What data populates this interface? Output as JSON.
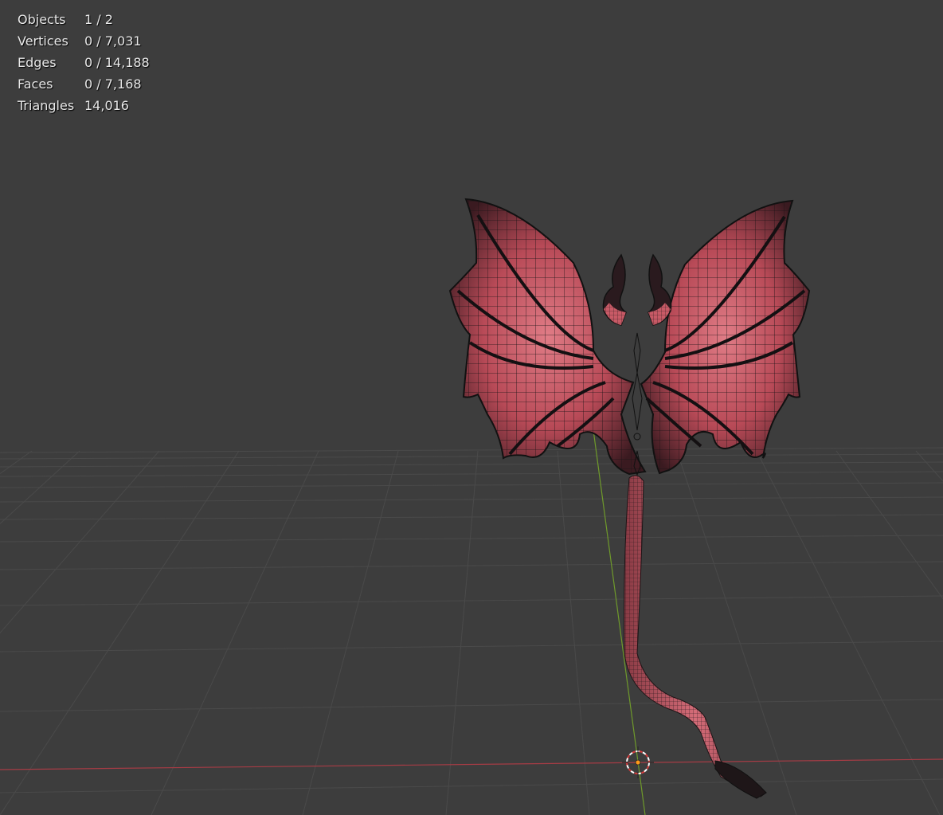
{
  "viewport": {
    "editor": "3D Viewport",
    "background_color": "#3d3d3d",
    "grid_color": "#4a4a4a",
    "x_axis_color": "#a63c45",
    "y_axis_color": "#6f9a2b",
    "model_color": "#c85a66",
    "model_wire_color": "#1c1416"
  },
  "stats": {
    "objects_label": "Objects",
    "objects_value": "1 / 2",
    "vertices_label": "Vertices",
    "vertices_value": "0 / 7,031",
    "edges_label": "Edges",
    "edges_value": "0 / 14,188",
    "faces_label": "Faces",
    "faces_value": "0 / 7,168",
    "triangles_label": "Triangles",
    "triangles_value": "14,016"
  },
  "icons": {
    "cursor": "3d-cursor-icon",
    "origin": "object-origin-icon"
  }
}
